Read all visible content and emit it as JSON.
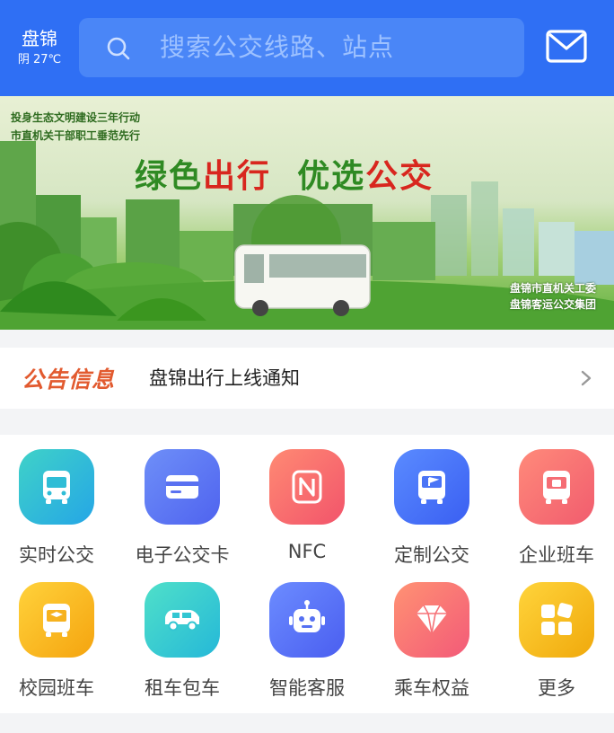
{
  "header": {
    "city": "盘锦",
    "weather": "阴 27℃",
    "search_placeholder": "搜索公交线路、站点",
    "icons": [
      "search-icon",
      "mail-icon"
    ]
  },
  "banner": {
    "slogan_line1": "投身生态文明建设三年行动",
    "slogan_line2": "市直机关干部职工垂范先行",
    "headline_1a": "绿色",
    "headline_1b": "出行",
    "headline_2a": "优选",
    "headline_2b": "公交",
    "org_line1": "盘锦市直机关工委",
    "org_line2": "盘锦客运公交集团"
  },
  "notice": {
    "tag": "公告信息",
    "text": "盘锦出行上线通知",
    "icon": "chevron-right-icon"
  },
  "services": [
    {
      "label": "实时公交",
      "icon": "bus-icon",
      "color_from": "#3fd2c8",
      "color_to": "#25a6e6"
    },
    {
      "label": "电子公交卡",
      "icon": "card-icon",
      "color_from": "#6e8ff8",
      "color_to": "#4f63ef"
    },
    {
      "label": "NFC",
      "icon": "nfc-icon",
      "color_from": "#ff8a73",
      "color_to": "#f2546b"
    },
    {
      "label": "定制公交",
      "icon": "custom-bus-icon",
      "color_from": "#5a8bff",
      "color_to": "#3a5ff2"
    },
    {
      "label": "企业班车",
      "icon": "enterprise-bus-icon",
      "color_from": "#ff8a7a",
      "color_to": "#f15c6e"
    },
    {
      "label": "校园班车",
      "icon": "school-bus-icon",
      "color_from": "#ffd23b",
      "color_to": "#f5a40f"
    },
    {
      "label": "租车包车",
      "icon": "car-icon",
      "color_from": "#4fe0c9",
      "color_to": "#25b8d8"
    },
    {
      "label": "智能客服",
      "icon": "robot-icon",
      "color_from": "#6c8cff",
      "color_to": "#4a5ef0"
    },
    {
      "label": "乘车权益",
      "icon": "diamond-icon",
      "color_from": "#ff9273",
      "color_to": "#f35a78"
    },
    {
      "label": "更多",
      "icon": "more-apps-icon",
      "color_from": "#ffd43b",
      "color_to": "#f0a90c"
    }
  ],
  "colors": {
    "header": "#2f6ff4",
    "notice_tag": "#e25a2f"
  }
}
